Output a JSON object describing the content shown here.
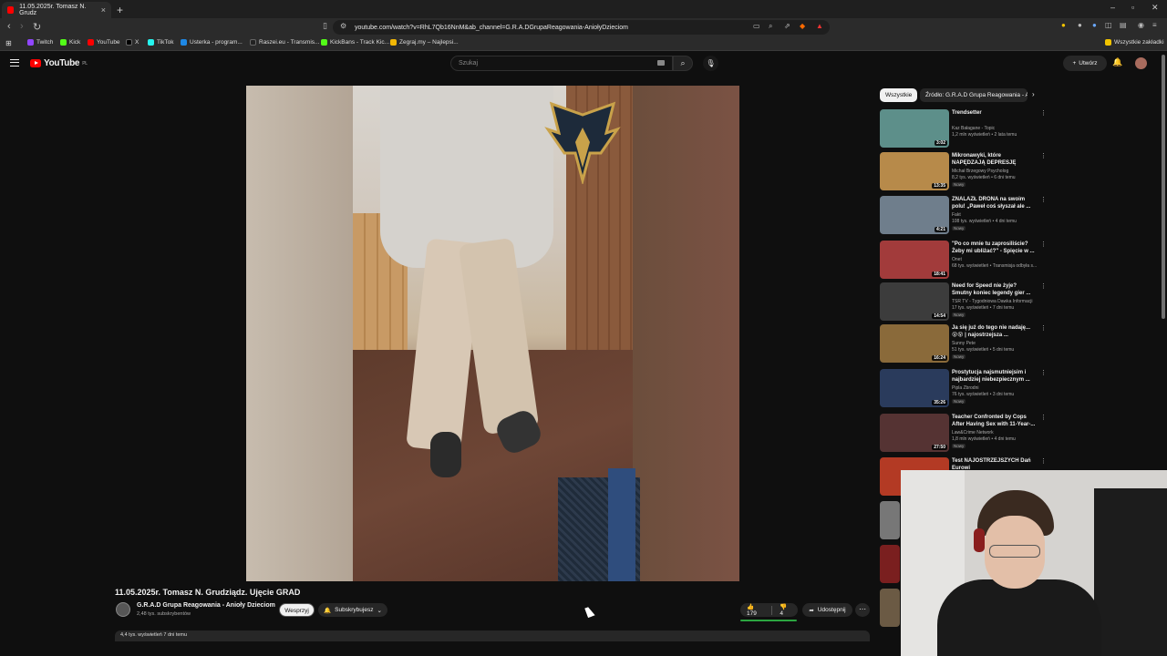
{
  "browser": {
    "tab_title": "11.05.2025r. Tomasz N. Grudz",
    "url": "youtube.com/watch?v=RhL7Qb16NnM&ab_channel=G.R.A.DGrupaReagowania-AniołyDzieciom",
    "bookmarks": [
      {
        "label": "Twitch",
        "color": "#9146ff"
      },
      {
        "label": "Kick",
        "color": "#53fc18"
      },
      {
        "label": "YouTube",
        "color": "#ff0000"
      },
      {
        "label": "X",
        "color": "#000000"
      },
      {
        "label": "TikTok",
        "color": "#25f4ee"
      },
      {
        "label": "Usterka - program...",
        "color": "#1e88e5"
      },
      {
        "label": "Raszei.eu - Transmis...",
        "color": "#222222"
      },
      {
        "label": "KickBans - Track Kic...",
        "color": "#53fc18"
      },
      {
        "label": "Zegraj.my – Najlepsi...",
        "color": "#f2b705"
      }
    ],
    "all_bookmarks": "Wszystkie zakładki"
  },
  "yt": {
    "logo": "YouTube",
    "region": "PL",
    "search_placeholder": "Szukaj",
    "create_label": "Utwórz"
  },
  "video": {
    "title": "11.05.2025r. Tomasz N. Grudziądz. Ujęcie GRAD",
    "channel": "G.R.A.D Grupa Reagowania - Anioły Dzieciom",
    "subscribers": "2,48 tys. subskrybentów",
    "support_label": "Wesprzyj",
    "subscribed_label": "Subskrybujesz",
    "likes": "179",
    "dislikes": "4",
    "share_label": "Udostępnij",
    "description_preview": "4,4 tys. wyświetleń  7 dni temu"
  },
  "sidebar": {
    "chips": [
      "Wszystkie",
      "Źródło: G.R.A.D Grupa Reagowania - A"
    ],
    "items": [
      {
        "title": "Trendsetter",
        "channel": "Kaz Bałagane - Topic",
        "meta": "1,2 mln wyświetleń • 2 lata temu",
        "duration": "3:02",
        "badge": "",
        "thumb": "#5d8f8a"
      },
      {
        "title": "Mikronawyki, które NAPĘDZAJĄ DEPRESJĘ",
        "channel": "Michał Brzegowy Psycholog",
        "meta": "8,2 tys. wyświetleń • 6 dni temu",
        "duration": "13:35",
        "badge": "Nowy",
        "thumb": "#b78a4a"
      },
      {
        "title": "ZNALAZŁ DRONA na swoim polu! „Paweł coś słyszał ale ...",
        "channel": "Fakt",
        "meta": "108 tys. wyświetleń • 4 dni temu",
        "duration": "4:21",
        "badge": "Nowy",
        "thumb": "#6f7e8c"
      },
      {
        "title": "\"Po co mnie tu zaprosiliście? Żeby mi ubliżać?\" - Spięcie w ...",
        "channel": "Onet",
        "meta": "68 tys. wyświetleń • Transmisja odbyła s...",
        "duration": "18:41",
        "badge": "",
        "thumb": "#a23b3b"
      },
      {
        "title": "Need for Speed nie żyje? Smutny koniec legendy gier ...",
        "channel": "TSR TV - Tygodniowa Dawka Informacji",
        "meta": "17 tys. wyświetleń • 7 dni temu",
        "duration": "14:54",
        "badge": "Nowy",
        "thumb": "#3c3c3c"
      },
      {
        "title": "Ja się już do tego nie nadaję... 😵😵 | najostrzejsza ...",
        "channel": "Sunny Pete",
        "meta": "51 tys. wyświetleń • 5 dni temu",
        "duration": "16:24",
        "badge": "Nowy",
        "thumb": "#8a6a3a"
      },
      {
        "title": "Prostytucja najsmutniejsim i najbardziej niebezpiecznym ...",
        "channel": "Pipla Zbrodni",
        "meta": "76 tys. wyświetleń • 3 dni temu",
        "duration": "35:26",
        "badge": "Nowy",
        "thumb": "#2a3b5c"
      },
      {
        "title": "Teacher Confronted by Cops After Having Sex with 11-Year-...",
        "channel": "Law&Crime Network",
        "meta": "1,8 mln wyświetleń • 4 dni temu",
        "duration": "27:50",
        "badge": "Nowy",
        "thumb": "#553333"
      },
      {
        "title": "Test NAJOSTRZEJSZYCH Dań Eurowi",
        "channel": "",
        "meta": "",
        "duration": "",
        "badge": "",
        "thumb": "#b33a24"
      }
    ]
  }
}
